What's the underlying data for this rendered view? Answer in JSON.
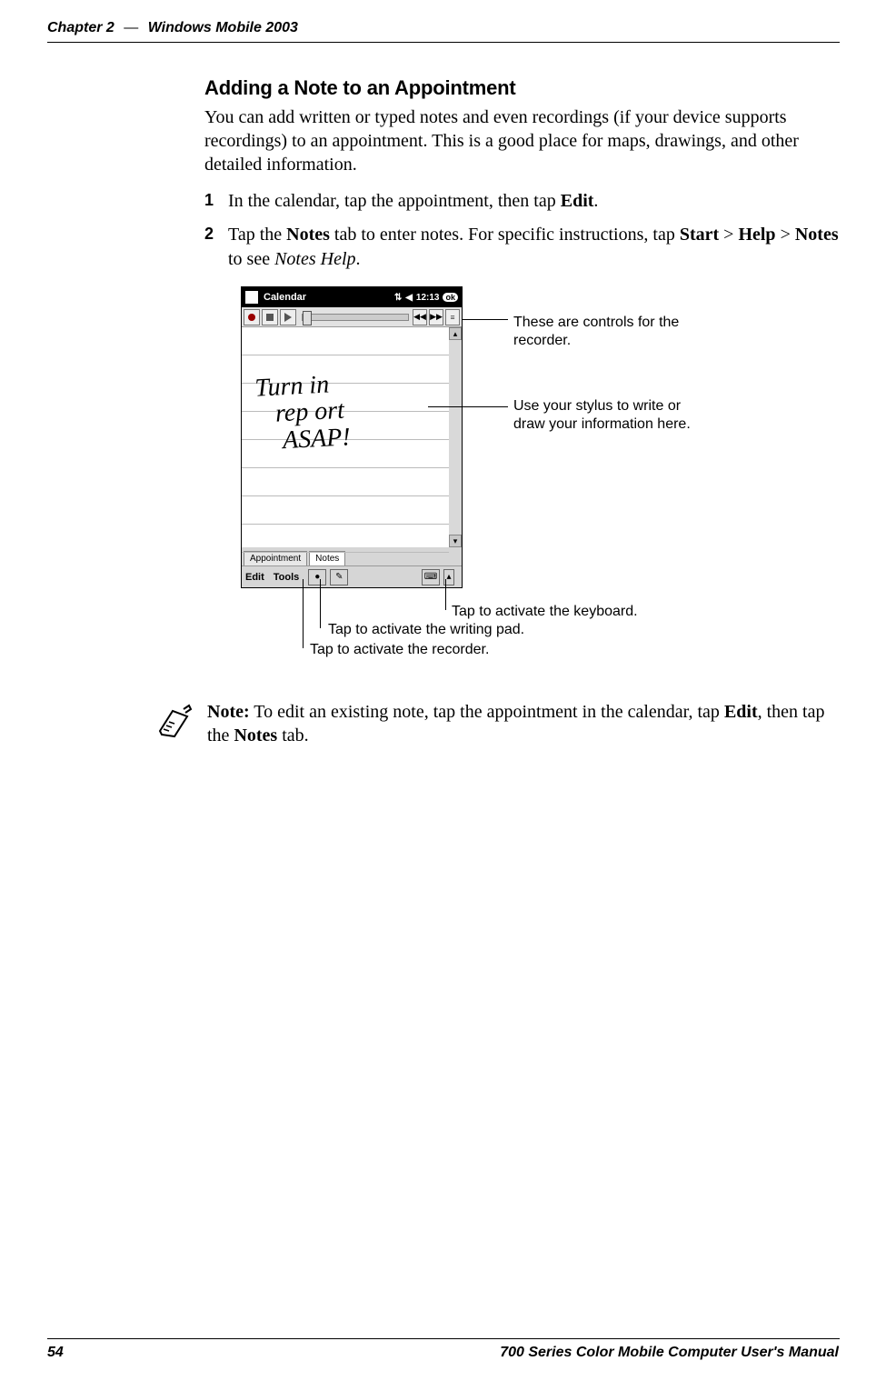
{
  "header": {
    "chapter": "Chapter 2",
    "sep": "—",
    "title": "Windows Mobile 2003"
  },
  "section": {
    "heading": "Adding a Note to an Appointment",
    "intro": "You can add written or typed notes and even recordings (if your device supports recordings) to an appointment. This is a good place for maps, drawings, and other detailed information.",
    "steps": [
      {
        "num": "1",
        "pre": "In the calendar, tap the appointment, then tap ",
        "b1": "Edit",
        "post": "."
      },
      {
        "num": "2",
        "pre": "Tap the ",
        "b1": "Notes",
        "mid1": " tab to enter notes. For specific instructions, tap ",
        "b2": "Start",
        "mid2": " > ",
        "b3": "Help",
        "mid3": " > ",
        "b4": "Notes",
        "mid4": " to see ",
        "i1": "Notes Help",
        "post": "."
      }
    ]
  },
  "device": {
    "titlebar": {
      "title": "Calendar",
      "time": "12:13",
      "ok": "ok"
    },
    "handwriting": "Turn in\n   rep ort\n    ASAP!",
    "tabs": {
      "appointment": "Appointment",
      "notes": "Notes"
    },
    "menu": {
      "edit": "Edit",
      "tools": "Tools"
    }
  },
  "callouts": {
    "c1": "These are controls for the recorder.",
    "c2": "Use your stylus to write or draw your information here.",
    "c3": "Tap to activate the keyboard.",
    "c4": "Tap to activate the writing pad.",
    "c5": "Tap to activate the recorder."
  },
  "note": {
    "label": "Note:",
    "pre": " To edit an existing note, tap the appointment in the calendar, tap ",
    "b1": "Edit",
    "mid": ", then tap the ",
    "b2": "Notes",
    "post": " tab."
  },
  "footer": {
    "page": "54",
    "title": "700 Series Color Mobile Computer User's Manual"
  }
}
